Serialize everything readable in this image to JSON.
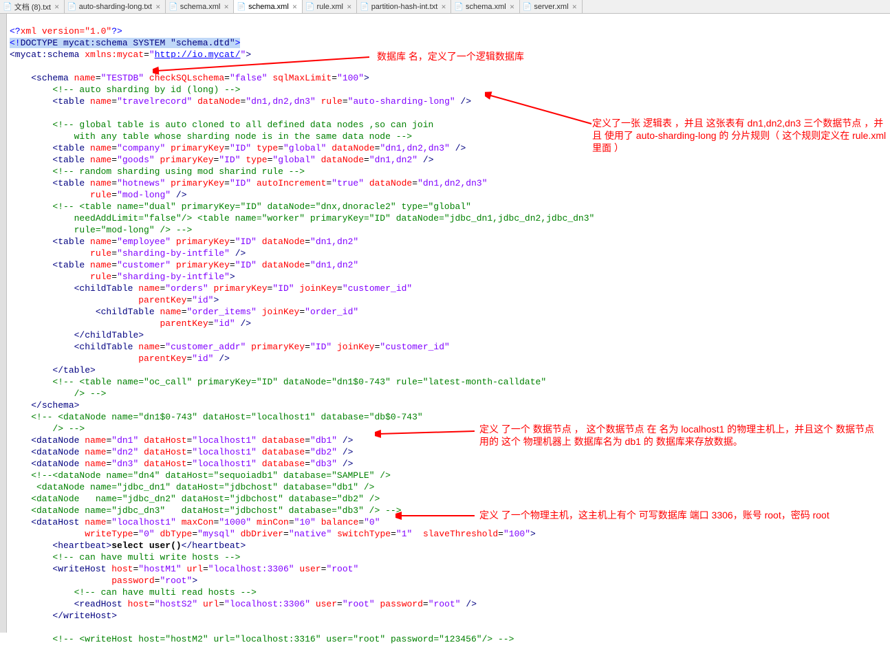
{
  "tabs": [
    {
      "label": "文档 (8).txt",
      "active": false
    },
    {
      "label": "auto-sharding-long.txt",
      "active": false
    },
    {
      "label": "schema.xml",
      "active": false
    },
    {
      "label": "schema.xml",
      "active": true
    },
    {
      "label": "rule.xml",
      "active": false
    },
    {
      "label": "partition-hash-int.txt",
      "active": false
    },
    {
      "label": "schema.xml",
      "active": false
    },
    {
      "label": "server.xml",
      "active": false
    }
  ],
  "annotations": {
    "a1": "数据库 名，定义了一个逻辑数据库",
    "a2": "定义了一张 逻辑表 ，并且 这张表有  dn1,dn2,dn3 三个数据节点 ，并且 使用了  auto-sharding-long 的 分片规则（  这个规则定义在  rule.xml里面 ）",
    "a3": "定义 了一个  数据节点 ， 这个数据节点 在  名为 localhost1 的物理主机上，并且这个 数据节点 用的 这个 物理机器上 数据库名为 db1 的 数据库来存放数据。",
    "a4": "定义 了一个物理主机，这主机上有个 可写数据库 端口 3306，账号 root，密码 root"
  },
  "code": {
    "l1_pi": "<?xml version=\"1.0\"?>",
    "l2_doctype": "<!DOCTYPE mycat:schema SYSTEM \"schema.dtd\">",
    "ns_url": "http://io.mycat/",
    "schema_name": "TESTDB",
    "sqlmax": "100",
    "travelrecord_dn": "dn1,dn2,dn3",
    "travelrecord_rule": "auto-sharding-long",
    "company_dn": "dn1,dn2,dn3",
    "goods_dn": "dn1,dn2",
    "hotnews_dn": "dn1,dn2,dn3",
    "employee_dn": "dn1,dn2",
    "customer_dn": "dn1,dn2",
    "dn1_host": "localhost1",
    "dn1_db": "db1",
    "dn2_host": "localhost1",
    "dn2_db": "db2",
    "dn3_host": "localhost1",
    "dn3_db": "db3",
    "dh_name": "localhost1",
    "dh_maxcon": "1000",
    "dh_mincon": "10",
    "dh_balance": "0",
    "dh_writetype": "0",
    "dh_dbtype": "mysql",
    "dh_driver": "native",
    "dh_switch": "1",
    "dh_slave": "100",
    "wh_host": "hostM1",
    "wh_url": "localhost:3306",
    "wh_user": "root",
    "wh_pwd": "root",
    "rh_host": "hostS2",
    "rh_url": "localhost:3306",
    "rh_user": "root",
    "rh_pwd": "root",
    "wh2_host": "hostM2",
    "wh2_url": "localhost:3316",
    "wh2_user": "root",
    "wh2_pwd": "123456",
    "fn_select": "select user()"
  }
}
